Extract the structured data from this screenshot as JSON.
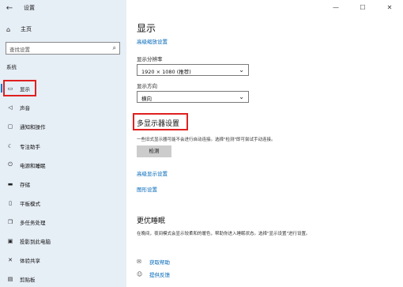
{
  "window": {
    "title": "设置",
    "controls": {
      "minimize": "—",
      "maximize": "☐",
      "close": "✕"
    }
  },
  "sidebar": {
    "home_label": "主页",
    "search_placeholder": "查找设置",
    "section": "系统",
    "items": [
      {
        "label": "显示",
        "icon": "monitor-icon",
        "glyph": "▭"
      },
      {
        "label": "声音",
        "icon": "speaker-icon",
        "glyph": "◁"
      },
      {
        "label": "通知和操作",
        "icon": "notification-icon",
        "glyph": "▢"
      },
      {
        "label": "专注助手",
        "icon": "moon-icon",
        "glyph": "☾"
      },
      {
        "label": "电源和睡眠",
        "icon": "power-icon",
        "glyph": "⏻"
      },
      {
        "label": "存储",
        "icon": "storage-icon",
        "glyph": "▬"
      },
      {
        "label": "平板模式",
        "icon": "tablet-icon",
        "glyph": "▯"
      },
      {
        "label": "多任务处理",
        "icon": "multitask-icon",
        "glyph": "❐"
      },
      {
        "label": "投影到此电脑",
        "icon": "project-icon",
        "glyph": "▣"
      },
      {
        "label": "体验共享",
        "icon": "share-icon",
        "glyph": "✕"
      },
      {
        "label": "剪贴板",
        "icon": "clipboard-icon",
        "glyph": "▤"
      }
    ]
  },
  "main": {
    "title": "显示",
    "advanced_scaling_link": "高级缩放设置",
    "resolution": {
      "label": "显示分辨率",
      "value": "1920 × 1080 (推荐)"
    },
    "orientation": {
      "label": "显示方向",
      "value": "横向"
    },
    "multi_display": {
      "title": "多显示器设置",
      "description": "一些旧式显示器可能不会进行自动连接。选择\"检测\"即可尝试手动连接。",
      "detect_button": "检测"
    },
    "advanced_display_link": "高级显示设置",
    "graphics_link": "图形设置",
    "sleep": {
      "title": "更优睡眠",
      "description": "在晚间，夜间模式会显示较柔和的暖色，帮助你进入睡眠状态。选择\"显示设置\"进行设置。"
    },
    "help": {
      "get_help": "获取帮助",
      "feedback": "提供反馈"
    }
  }
}
